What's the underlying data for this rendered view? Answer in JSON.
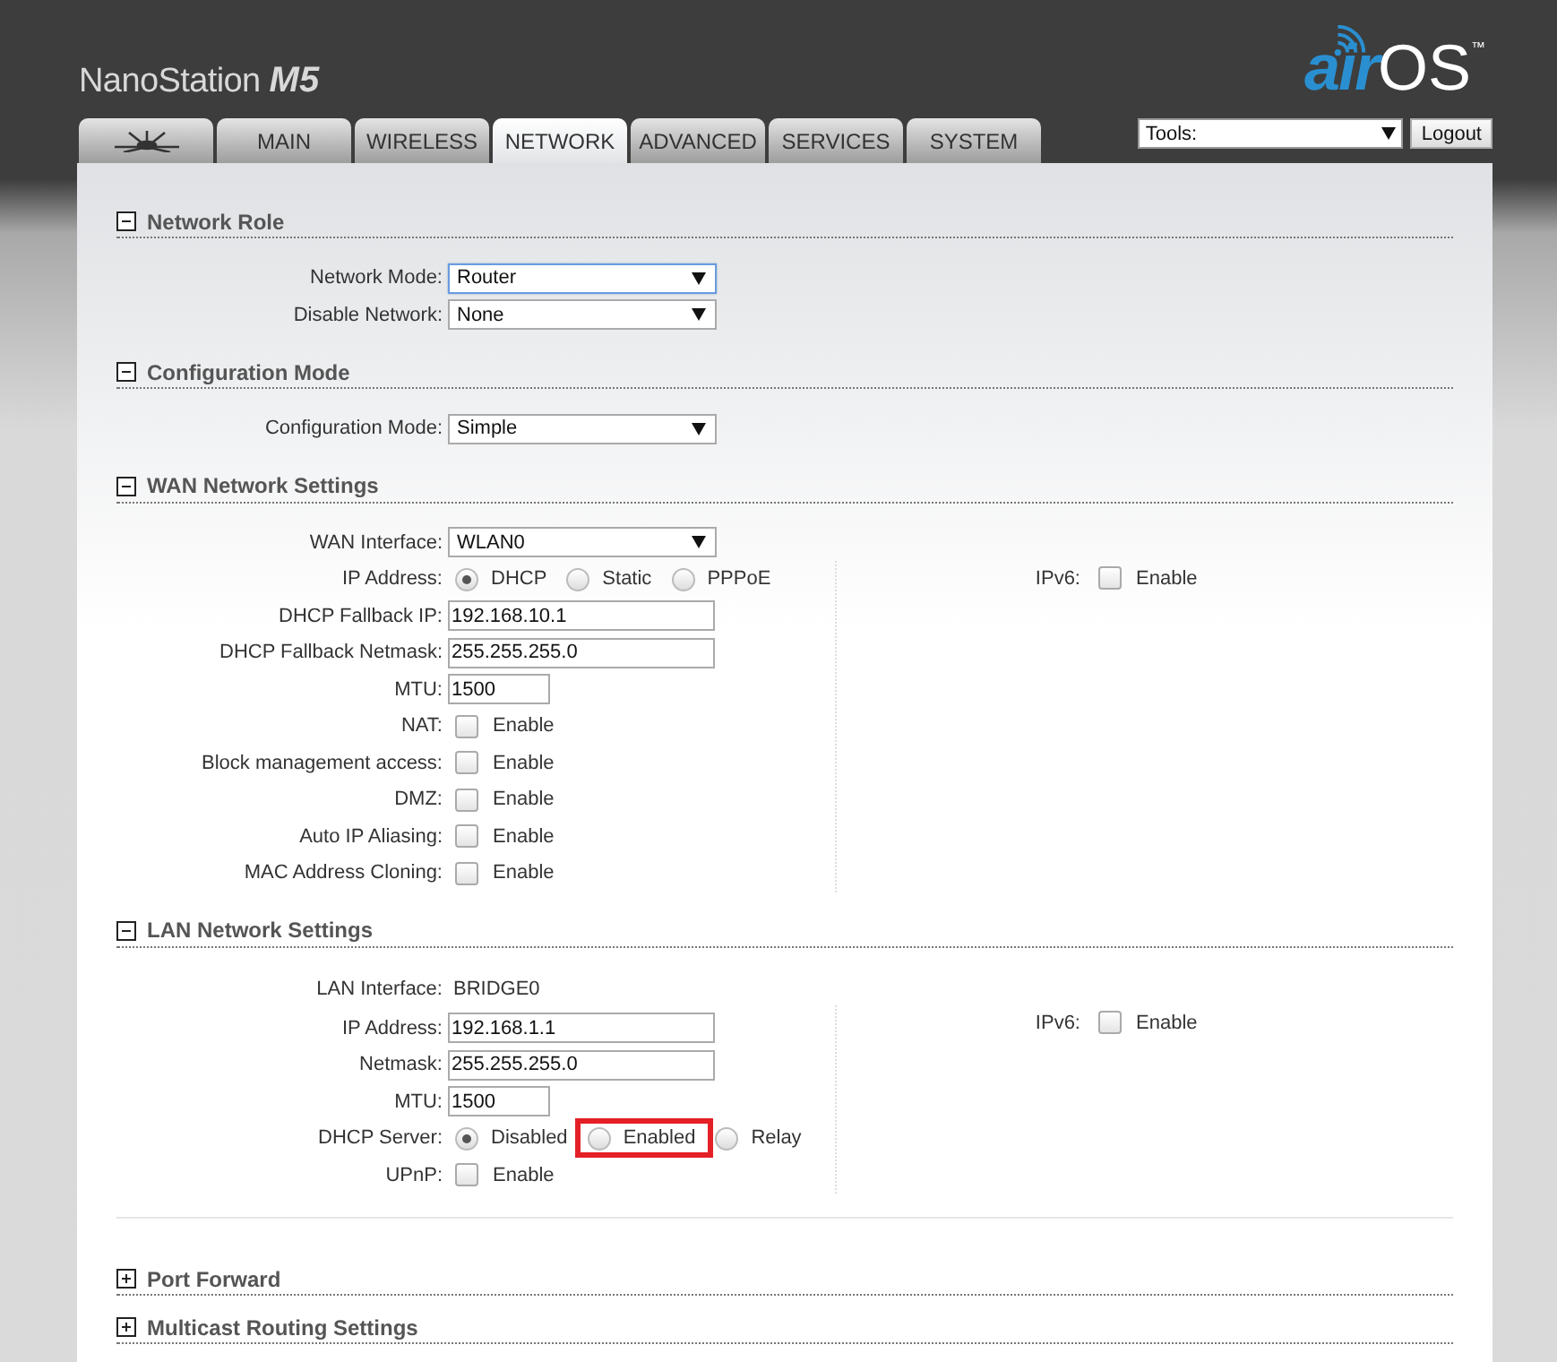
{
  "header": {
    "product": "NanoStation",
    "model": "M5",
    "logo": {
      "prefix": "air",
      "suffix": "OS",
      "trademark": "™"
    }
  },
  "tabs": [
    {
      "kind": "icon",
      "selected": false
    },
    {
      "kind": "text",
      "label": "MAIN",
      "selected": false
    },
    {
      "kind": "text",
      "label": "WIRELESS",
      "selected": false
    },
    {
      "kind": "text",
      "label": "NETWORK",
      "selected": true
    },
    {
      "kind": "text",
      "label": "ADVANCED",
      "selected": false
    },
    {
      "kind": "text",
      "label": "SERVICES",
      "selected": false
    },
    {
      "kind": "text",
      "label": "SYSTEM",
      "selected": false
    }
  ],
  "tools": {
    "value": "Tools:"
  },
  "logout": "Logout",
  "sections": [
    {
      "title": "Network Role",
      "expanded": true,
      "rows": [
        {
          "kind": "select",
          "label": "Network Mode:",
          "value": "Router",
          "focused": true
        },
        {
          "kind": "select",
          "label": "Disable Network:",
          "value": "None",
          "focused": false
        }
      ]
    },
    {
      "title": "Configuration Mode",
      "expanded": true,
      "rows": [
        {
          "kind": "select",
          "label": "Configuration Mode:",
          "value": "Simple",
          "focused": false
        }
      ]
    },
    {
      "title": "WAN Network Settings",
      "expanded": true,
      "rows": [
        {
          "kind": "select",
          "label": "WAN Interface:",
          "value": "WLAN0",
          "focused": false
        },
        {
          "kind": "radio",
          "label": "IP Address:",
          "options": [
            {
              "label": "DHCP",
              "selected": true,
              "highlighted": false
            },
            {
              "label": "Static",
              "selected": false,
              "highlighted": false
            },
            {
              "label": "PPPoE",
              "selected": false,
              "highlighted": false
            }
          ]
        },
        {
          "kind": "input",
          "label": "DHCP Fallback IP:",
          "value": "192.168.10.1"
        },
        {
          "kind": "input",
          "label": "DHCP Fallback Netmask:",
          "value": "255.255.255.0"
        },
        {
          "kind": "short-input",
          "label": "MTU:",
          "value": "1500"
        },
        {
          "kind": "checkbox",
          "label": "NAT:",
          "option": "Enable",
          "checked": false
        },
        {
          "kind": "checkbox",
          "label": "Block management access:",
          "option": "Enable",
          "checked": false
        },
        {
          "kind": "checkbox",
          "label": "DMZ:",
          "option": "Enable",
          "checked": false
        },
        {
          "kind": "checkbox",
          "label": "Auto IP Aliasing:",
          "option": "Enable",
          "checked": false
        },
        {
          "kind": "checkbox",
          "label": "MAC Address Cloning:",
          "option": "Enable",
          "checked": false
        }
      ],
      "side_rows": [
        {
          "kind": "checkbox",
          "label": "IPv6:",
          "option": "Enable",
          "checked": false
        }
      ]
    },
    {
      "title": "LAN Network Settings",
      "expanded": true,
      "rows": [
        {
          "kind": "text",
          "label": "LAN Interface:",
          "value": "BRIDGE0"
        },
        {
          "kind": "input",
          "label": "IP Address:",
          "value": "192.168.1.1"
        },
        {
          "kind": "input",
          "label": "Netmask:",
          "value": "255.255.255.0"
        },
        {
          "kind": "short-input",
          "label": "MTU:",
          "value": "1500"
        },
        {
          "kind": "radio",
          "label": "DHCP Server:",
          "options": [
            {
              "label": "Disabled",
              "selected": true,
              "highlighted": false
            },
            {
              "label": "Enabled",
              "selected": false,
              "highlighted": true
            },
            {
              "label": "Relay",
              "selected": false,
              "highlighted": false
            }
          ]
        },
        {
          "kind": "checkbox",
          "label": "UPnP:",
          "option": "Enable",
          "checked": false
        }
      ],
      "side_rows": [
        {
          "kind": "checkbox",
          "label": "IPv6:",
          "option": "Enable",
          "checked": false
        }
      ]
    },
    {
      "title": "Port Forward",
      "expanded": false
    },
    {
      "title": "Multicast Routing Settings",
      "expanded": false
    }
  ]
}
